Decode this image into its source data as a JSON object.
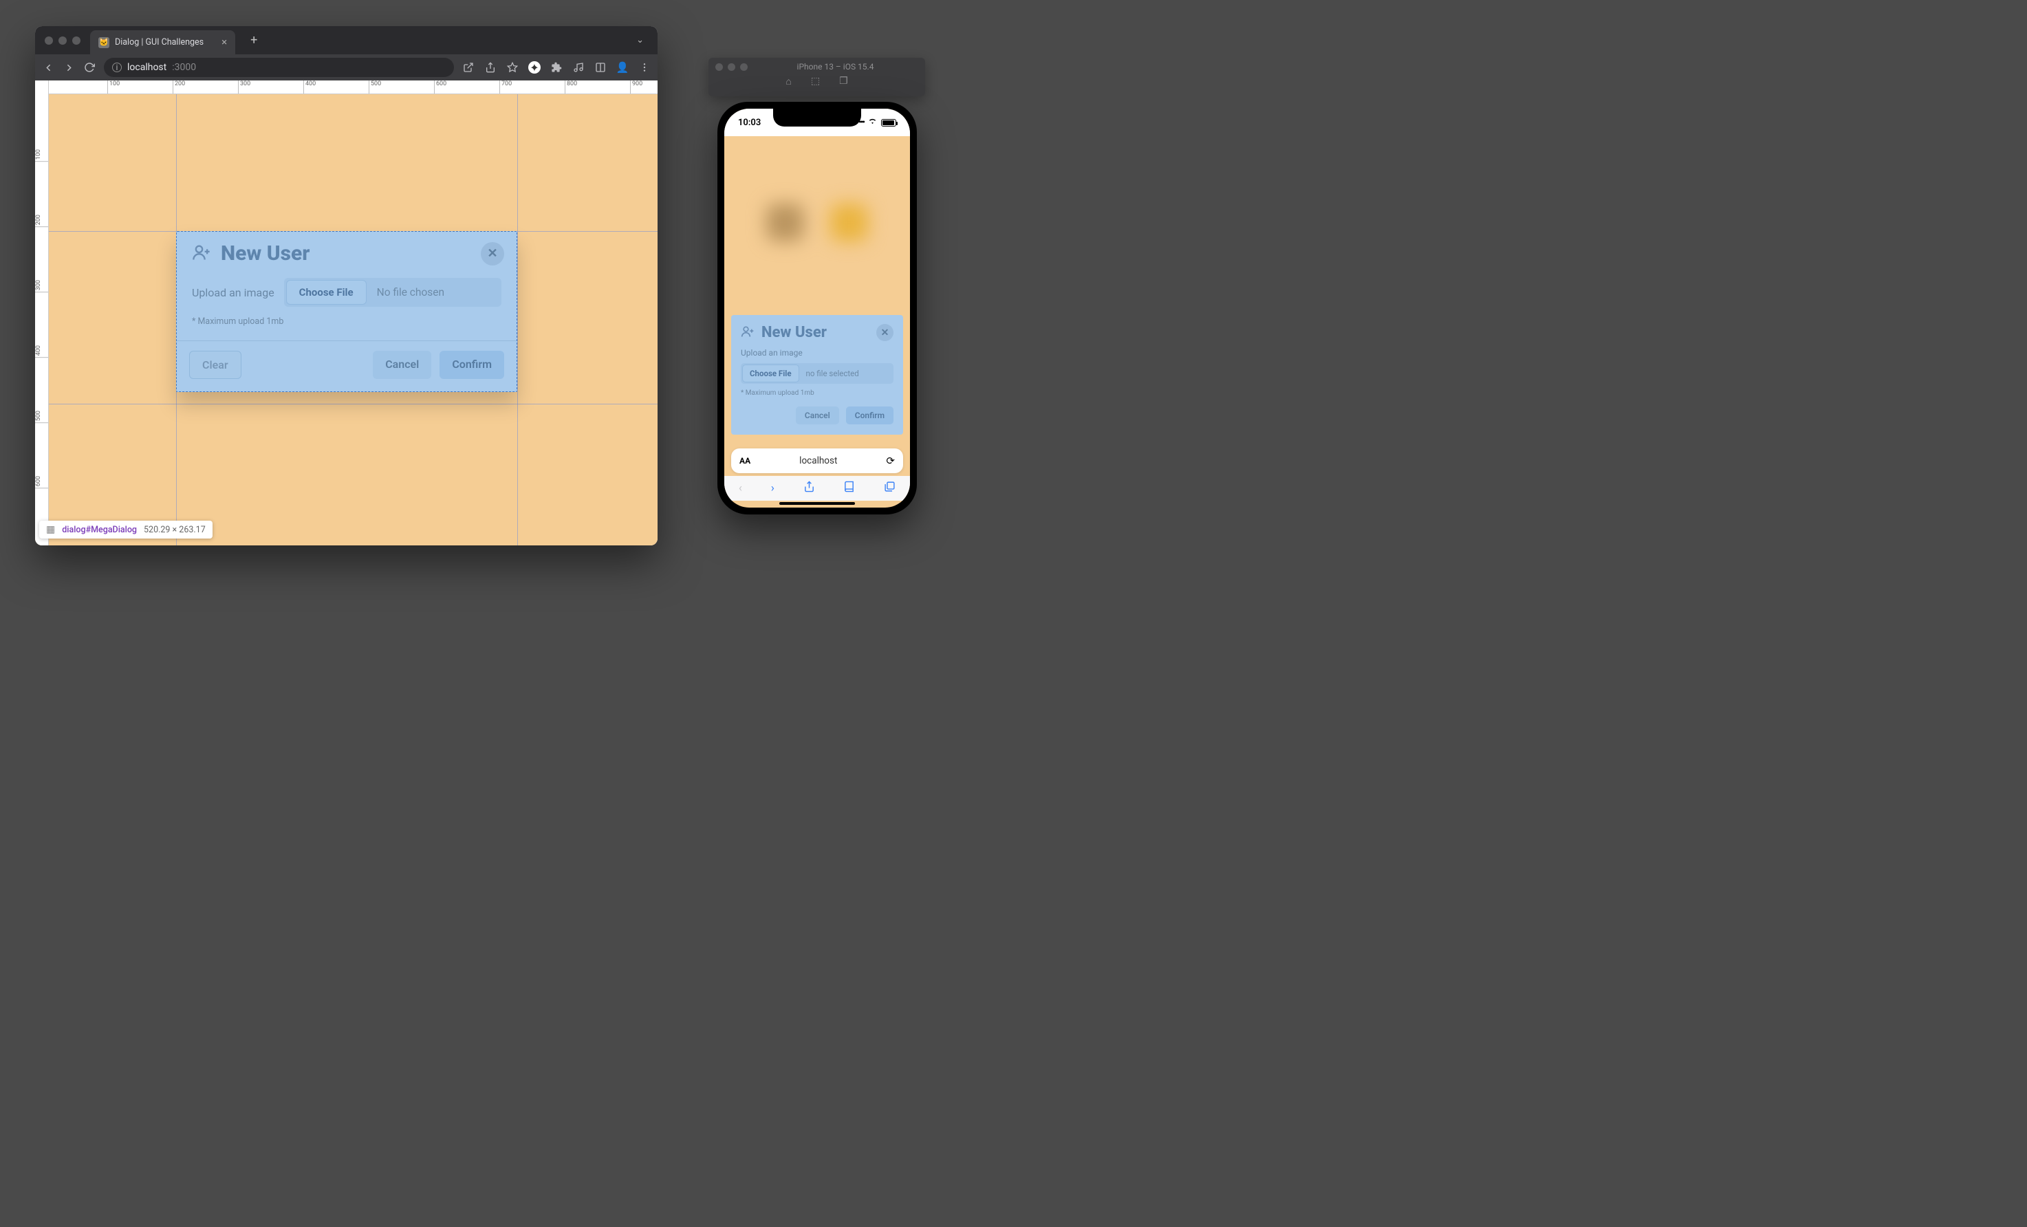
{
  "desktop": {
    "tab_title": "Dialog | GUI Challenges",
    "url_host": "localhost",
    "url_port": ":3000",
    "ruler_ticks": [
      "100",
      "200",
      "300",
      "400",
      "500",
      "600",
      "700",
      "800",
      "900"
    ],
    "ruler_ticks_v": [
      "100",
      "200",
      "300",
      "400",
      "500",
      "600"
    ],
    "inspector": {
      "selector": "dialog#MegaDialog",
      "dimensions": "520.29 × 263.17"
    }
  },
  "dialog": {
    "title": "New User",
    "upload_label": "Upload an image",
    "choose_file": "Choose File",
    "no_file": "No file chosen",
    "hint": "* Maximum upload 1mb",
    "clear": "Clear",
    "cancel": "Cancel",
    "confirm": "Confirm"
  },
  "simulator": {
    "title": "iPhone 13 – iOS 15.4",
    "status_time": "10:03",
    "safari_address": "localhost",
    "m_no_file": "no file selected"
  }
}
